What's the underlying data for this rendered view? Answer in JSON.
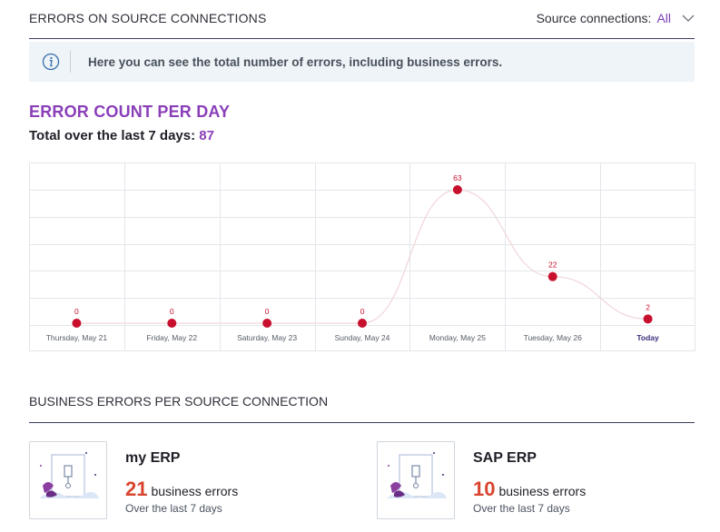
{
  "header": {
    "title": "ERRORS ON SOURCE CONNECTIONS",
    "filter_label": "Source connections:",
    "filter_value": "All"
  },
  "info": {
    "icon": "info-icon",
    "text": "Here you can see the total number of errors, including business errors."
  },
  "chart_section": {
    "title": "ERROR COUNT PER DAY",
    "total_label": "Total over the last 7 days:",
    "total_value": "87"
  },
  "chart_data": {
    "type": "line",
    "categories": [
      "Thursday, May 21",
      "Friday, May 22",
      "Saturday, May 23",
      "Sunday, May 24",
      "Monday, May 25",
      "Tuesday, May 26",
      "Today"
    ],
    "values": [
      0,
      0,
      0,
      0,
      63,
      22,
      2
    ],
    "ylim": [
      0,
      70
    ],
    "grid": true,
    "highlighted_category": "Today",
    "colors": {
      "point": "#c8102e",
      "line": "#f0d6da",
      "grid": "#e3e6ea",
      "label": "#c8102e",
      "today": "#3b2d7a"
    }
  },
  "business": {
    "title": "BUSINESS ERRORS PER SOURCE CONNECTION",
    "cards": [
      {
        "name": "my ERP",
        "count": "21",
        "count_label": "business errors",
        "period": "Over the last 7 days"
      },
      {
        "name": "SAP ERP",
        "count": "10",
        "count_label": "business errors",
        "period": "Over the last 7 days"
      }
    ]
  }
}
